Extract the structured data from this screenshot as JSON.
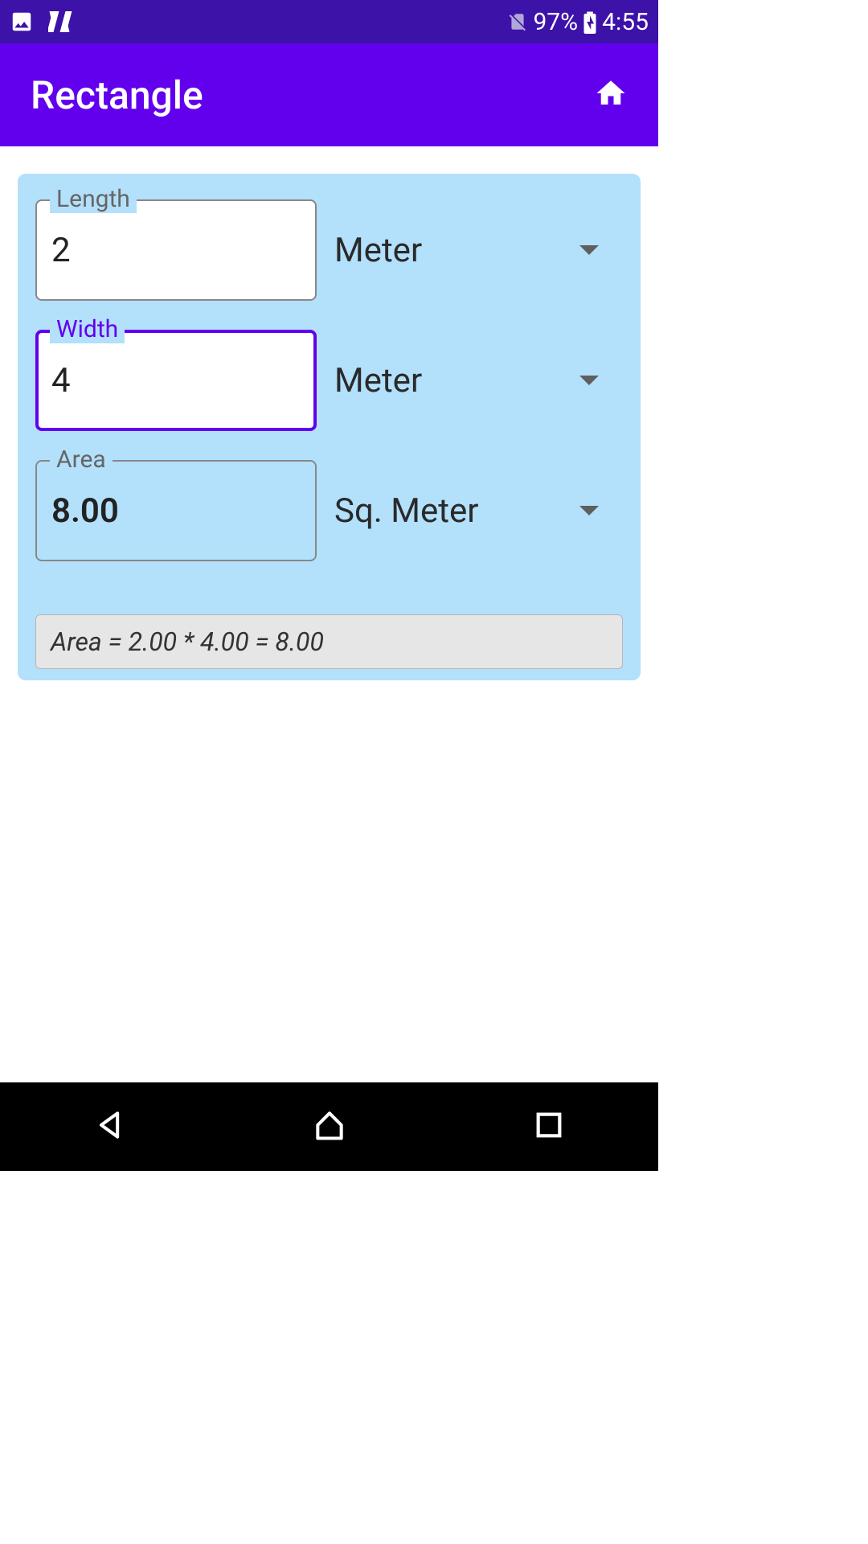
{
  "status": {
    "battery_percent": "97%",
    "time": "4:55"
  },
  "appbar": {
    "title": "Rectangle"
  },
  "fields": {
    "length": {
      "label": "Length",
      "value": "2",
      "unit": "Meter"
    },
    "width": {
      "label": "Width",
      "value": "4",
      "unit": "Meter"
    },
    "area": {
      "label": "Area",
      "value": "8.00",
      "unit": "Sq. Meter"
    }
  },
  "formula_text": "Area = 2.00 * 4.00 = 8.00"
}
